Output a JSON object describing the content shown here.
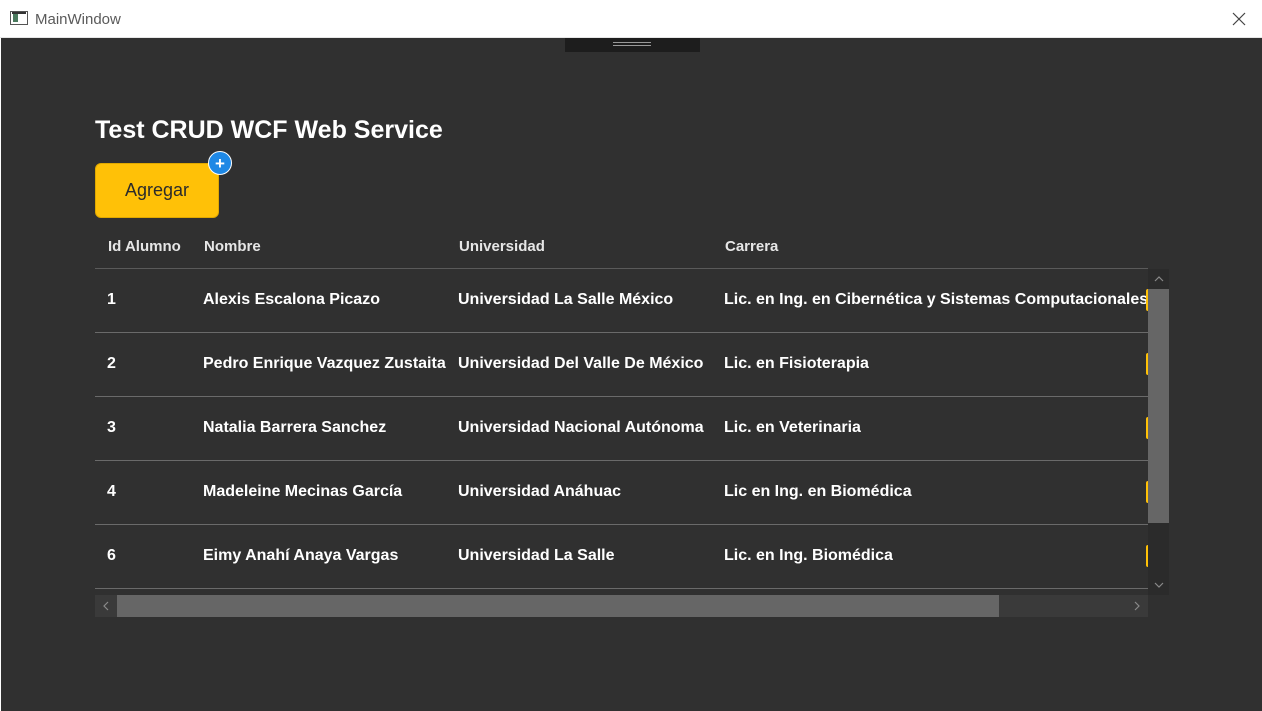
{
  "window": {
    "title": "MainWindow"
  },
  "page": {
    "title": "Test CRUD WCF Web Service"
  },
  "toolbar": {
    "add_label": "Agregar",
    "add_badge": "+"
  },
  "table": {
    "columns": [
      "Id Alumno",
      "Nombre",
      "Universidad",
      "Carrera"
    ],
    "rows": [
      {
        "id": "1",
        "nombre": "Alexis Escalona Picazo",
        "universidad": "Universidad La Salle México",
        "carrera": "Lic. en Ing. en Cibernética y Sistemas Computacionales"
      },
      {
        "id": "2",
        "nombre": "Pedro Enrique Vazquez Zustaita",
        "universidad": "Universidad Del Valle De México",
        "carrera": "Lic. en Fisioterapia"
      },
      {
        "id": "3",
        "nombre": "Natalia Barrera Sanchez",
        "universidad": "Universidad Nacional Autónoma",
        "carrera": "Lic. en Veterinaria"
      },
      {
        "id": "4",
        "nombre": "Madeleine Mecinas García",
        "universidad": "Universidad Anáhuac",
        "carrera": "Lic en Ing. en Biomédica"
      },
      {
        "id": "6",
        "nombre": "Eimy Anahí Anaya Vargas",
        "universidad": "Universidad La Salle",
        "carrera": "Lic. en Ing. Biomédica"
      }
    ]
  },
  "colors": {
    "background": "#303030",
    "accent": "#ffc107",
    "badge": "#1e88e5"
  },
  "icons": {
    "close": "close-icon",
    "app": "app-window-icon"
  }
}
